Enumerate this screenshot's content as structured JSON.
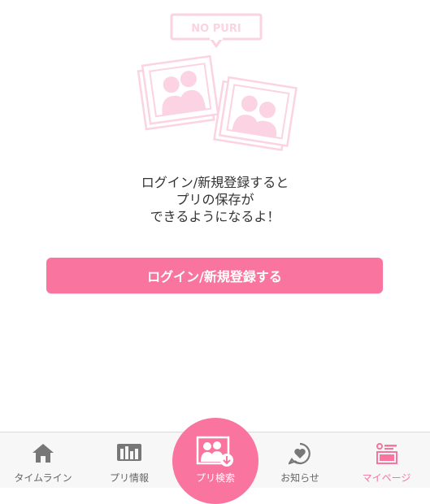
{
  "empty_state": {
    "badge_text": "NO PURI",
    "message_lines": [
      "ログイン/新規登録すると",
      "プリの保存が",
      "できるようになるよ！"
    ],
    "button_label": "ログイン/新規登録する"
  },
  "tabbar": {
    "tabs": [
      {
        "label": "タイムライン",
        "icon": "home-icon"
      },
      {
        "label": "プリ情報",
        "icon": "chart-icon"
      },
      {
        "label": "プリ検索",
        "icon": "photo-search-icon"
      },
      {
        "label": "お知らせ",
        "icon": "heart-bubble-icon"
      },
      {
        "label": "マイページ",
        "icon": "profile-card-icon"
      }
    ],
    "active_tab": "マイページ"
  },
  "colors": {
    "accent": "#f9749f",
    "illustration_pink": "#fbd3e2",
    "tab_icon_gray": "#777777"
  }
}
